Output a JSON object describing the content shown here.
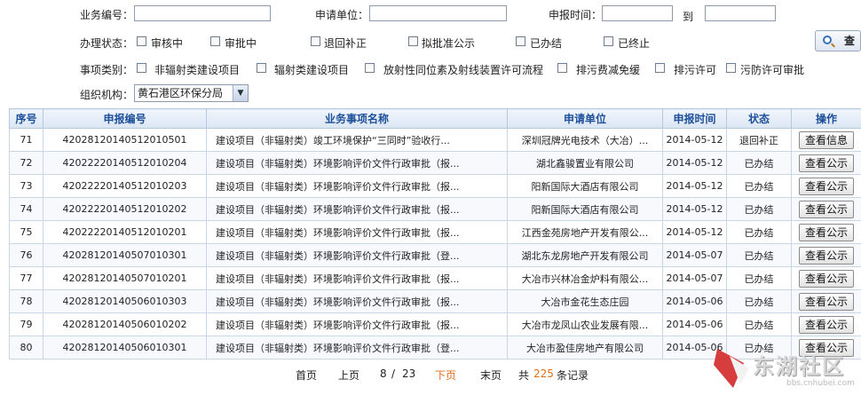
{
  "filters": {
    "business_no_label": "业务编号：",
    "business_no_value": "",
    "applicant_label": "申请单位：",
    "applicant_value": "",
    "date_label": "申报时间：",
    "date_from": "",
    "date_to_label": "到",
    "date_to": "",
    "status_label": "办理状态：",
    "status_options": [
      "审核中",
      "审批中",
      "退回补正",
      "拟批准公示",
      "已办结",
      "已终止"
    ],
    "type_label": "事项类别：",
    "type_options": [
      "非辐射类建设项目",
      "辐射类建设项目",
      "放射性同位素及射线装置许可流程",
      "排污费减免缓",
      "排污许可",
      "污防许可审批"
    ],
    "org_label": "组织机构：",
    "org_value": "黄石港区环保分局",
    "query_button": "查",
    "query_icon": "search-icon"
  },
  "table": {
    "columns": [
      "序号",
      "申报编号",
      "业务事项名称",
      "申请单位",
      "申报时间",
      "状态",
      "操作"
    ],
    "rows": [
      {
        "no": "71",
        "code": "4202812014051201050​1",
        "name": "建设项目（非辐射类）竣工环境保护“三同时”验收行...",
        "unit": "深圳冠牌光电技术（大冶）...",
        "date": "2014-05-12",
        "status": "退回补正",
        "action": "查看信息"
      },
      {
        "no": "72",
        "code": "420222201405120102​04",
        "name": "建设项目（非辐射类）环境影响评价文件行政审批（报...",
        "unit": "湖北鑫骏置业有限公司",
        "date": "2014-05-12",
        "status": "已办结",
        "action": "查看公示"
      },
      {
        "no": "73",
        "code": "420222201405120102​03",
        "name": "建设项目（非辐射类）环境影响评价文件行政审批（报...",
        "unit": "阳新国际大酒店有限公司",
        "date": "2014-05-12",
        "status": "已办结",
        "action": "查看公示"
      },
      {
        "no": "74",
        "code": "420222201405120102​02",
        "name": "建设项目（非辐射类）环境影响评价文件行政审批（报...",
        "unit": "阳新国际大酒店有限公司",
        "date": "2014-05-12",
        "status": "已办结",
        "action": "查看公示"
      },
      {
        "no": "75",
        "code": "420222201405120102​01",
        "name": "建设项目（非辐射类）环境影响评价文件行政审批（报...",
        "unit": "江西金苑房地产开发有限公...",
        "date": "2014-05-12",
        "status": "已办结",
        "action": "查看公示"
      },
      {
        "no": "76",
        "code": "420281201405070103​01",
        "name": "建设项目（非辐射类）环境影响评价文件行政审批（登...",
        "unit": "湖北东龙房地产开发有限公司",
        "date": "2014-05-07",
        "status": "已办结",
        "action": "查看公示"
      },
      {
        "no": "77",
        "code": "420281201405070102​01",
        "name": "建设项目（非辐射类）环境影响评价文件行政审批（报...",
        "unit": "大冶市兴林冶金炉料有限公...",
        "date": "2014-05-07",
        "status": "已办结",
        "action": "查看公示"
      },
      {
        "no": "78",
        "code": "420281201405060103​03",
        "name": "建设项目（非辐射类）环境影响评价文件行政审批（报...",
        "unit": "大冶市金花生态庄园",
        "date": "2014-05-06",
        "status": "已办结",
        "action": "查看公示"
      },
      {
        "no": "79",
        "code": "420281201405060102​02",
        "name": "建设项目（非辐射类）环境影响评价文件行政审批（报...",
        "unit": "大冶市龙凤山农业发展有限...",
        "date": "2014-05-06",
        "status": "已办结",
        "action": "查看公示"
      },
      {
        "no": "80",
        "code": "420281201405060103​01",
        "name": "建设项目（非辐射类）环境影响评价文件行政审批（登...",
        "unit": "大冶市盈佳房地产有限公司",
        "date": "2014-05-06",
        "status": "已办结",
        "action": "查看公示"
      }
    ]
  },
  "pager": {
    "first": "首页",
    "prev": "上页",
    "current": "8",
    "separator": "/",
    "total_pages": "23",
    "next": "下页",
    "last": "末页",
    "total_prefix": "共",
    "total_records": "225",
    "total_suffix": "条记录"
  },
  "watermark": {
    "text": "东湖社区",
    "url": "bbs.cnhubei.com"
  },
  "colors": {
    "header_text": "#1d4f9a",
    "highlight": "#e36d17",
    "watermark_red": "#d42d2d"
  }
}
